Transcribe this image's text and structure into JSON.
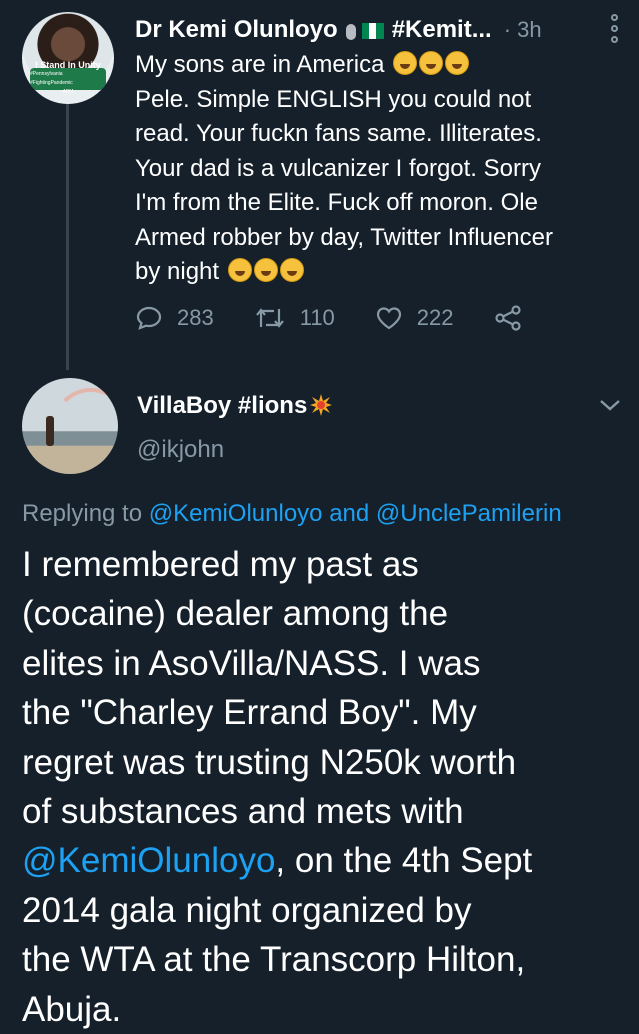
{
  "tweet1": {
    "avatar_text": "I Stand In Unity",
    "avatar_subtext": "#Pennsylvania #FightingPandemic",
    "avatar_logo": "APM",
    "display_name": "Dr Kemi Olunloyo",
    "display_name_suffix": "#Kemit...",
    "icons": [
      "microphone-icon",
      "nigeria-flag-icon"
    ],
    "time": "· 3h",
    "body_lines": [
      "My sons are in America",
      "Pele. Simple ENGLISH you could not",
      "read. Your fuckn fans same. Illiterates.",
      "Your dad is a vulcanizer I forgot. Sorry",
      "I'm from the Elite. Fuck off moron. Ole",
      "Armed robber by day, Twitter Influencer",
      "by night"
    ],
    "emoji_line1": [
      "crying-face-emoji",
      "crying-face-emoji",
      "crying-face-emoji"
    ],
    "emoji_line7": [
      "rofl-emoji",
      "rofl-emoji",
      "rofl-emoji"
    ],
    "replies": "283",
    "retweets": "110",
    "likes": "222"
  },
  "tweet2": {
    "display_name": "VillaBoy #lions",
    "handle": "@ikjohn",
    "replying_prefix": "Replying to",
    "replying_to_1": "@KemiOlunloyo",
    "replying_and": "and",
    "replying_to_2": "@UnclePamilerin",
    "body_part1": "I remembered my past as\n(cocaine) dealer among the\nelites in AsoVilla/NASS. I was\nthe \"Charley Errand Boy\". My\nregret was trusting N250k worth\nof substances and mets with\n",
    "body_mention": "@KemiOlunloyo",
    "body_part2": ", on the 4th Sept\n2014 gala night organized by\nthe WTA at the Transcorp Hilton,\nAbuja."
  },
  "colors": {
    "background": "#15202b",
    "text": "#ffffff",
    "secondary": "#8899a6",
    "link": "#1da1f2",
    "thread_line": "#38444d"
  }
}
